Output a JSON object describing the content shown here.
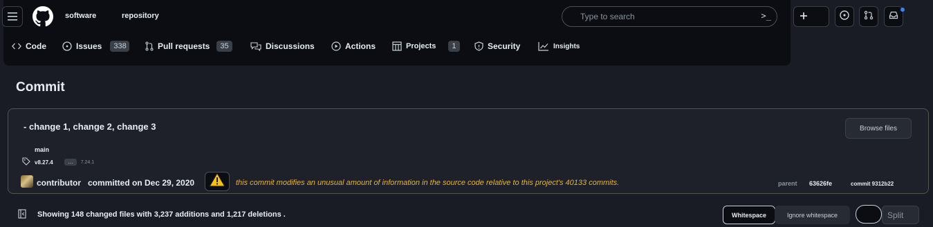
{
  "header": {
    "breadcrumb": [
      "software",
      "repository"
    ],
    "search_placeholder": "Type to search",
    "search_shortcut": ">_"
  },
  "icons": {
    "hamburger": "hamburger-icon",
    "logo": "github-logo-icon",
    "plus": "plus-icon",
    "issues": "issue-circle-icon",
    "pull_requests": "git-pull-request-icon",
    "inbox": "inbox-icon",
    "notification_color": "#3b82f6"
  },
  "tabs": [
    {
      "label": "Code",
      "icon": "code-icon"
    },
    {
      "label": "Issues",
      "count": "338",
      "icon": "issue-opened-icon"
    },
    {
      "label": "Pull requests",
      "count": "35",
      "icon": "git-pull-request-icon"
    },
    {
      "label": "Discussions",
      "icon": "comment-discussion-icon"
    },
    {
      "label": "Actions",
      "icon": "play-icon"
    },
    {
      "label": "Projects",
      "count": "1",
      "icon": "table-icon"
    },
    {
      "label": "Security",
      "icon": "shield-icon"
    },
    {
      "label": "Insights",
      "icon": "graph-icon"
    }
  ],
  "page": {
    "title": "Commit"
  },
  "commit": {
    "message": "- change 1, change 2, change 3",
    "browse_label": "Browse files",
    "branch": "main",
    "tag": "v8.27.4",
    "more_label": "…",
    "tag2": "7.24.1",
    "author": "contributor",
    "committed_text": "committed on Dec 29, 2020",
    "warning_text": "this commit modifies an unusual amount of information in the source code relative to this project's 40133 commits.",
    "warning_color": "#e3b341",
    "parent_label": "parent",
    "parent_sha": "63626fe",
    "commit_label": "commit 9312b22"
  },
  "diff": {
    "summary": "Showing 148 changed files with 3,237 additions and 1,217 deletions .",
    "whitespace_label": "Whitespace",
    "ignore_label": "Ignore whitespace",
    "split_label": "Split"
  }
}
